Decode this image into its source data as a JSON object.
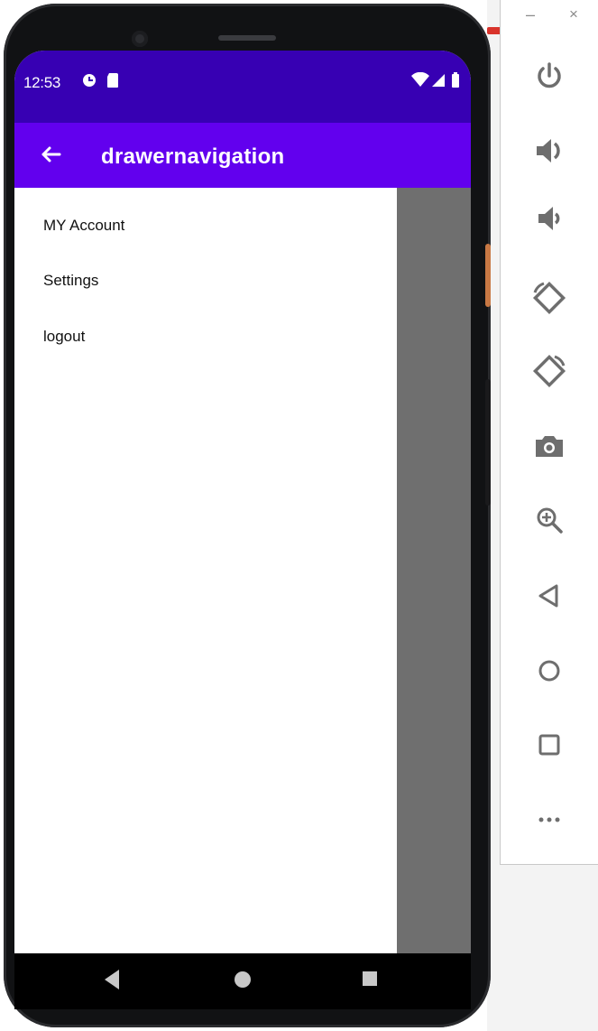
{
  "status_bar": {
    "time": "12:53",
    "icons": [
      "sync-icon",
      "sd-card-icon",
      "wifi-icon",
      "signal-icon",
      "battery-icon"
    ]
  },
  "app_bar": {
    "title": "drawernavigation",
    "back_icon": "arrow-left-icon"
  },
  "drawer": {
    "items": [
      {
        "label": "MY Account"
      },
      {
        "label": "Settings"
      },
      {
        "label": "logout"
      }
    ]
  },
  "nav_bar": {
    "icons": [
      "back-triangle-icon",
      "home-circle-icon",
      "recents-square-icon"
    ]
  },
  "emulator_toolbar": {
    "window_controls": {
      "minimize": "–",
      "close": "×"
    },
    "buttons": [
      "power-icon",
      "volume-up-icon",
      "volume-down-icon",
      "rotate-left-icon",
      "rotate-right-icon",
      "camera-icon",
      "zoom-in-icon",
      "back-icon",
      "home-icon",
      "overview-icon",
      "more-icon"
    ]
  },
  "colors": {
    "status_bar": "#3700b3",
    "app_bar": "#6200ee",
    "scrim": "#6f6f6f",
    "toolbar_icon": "#6e6e6e"
  }
}
